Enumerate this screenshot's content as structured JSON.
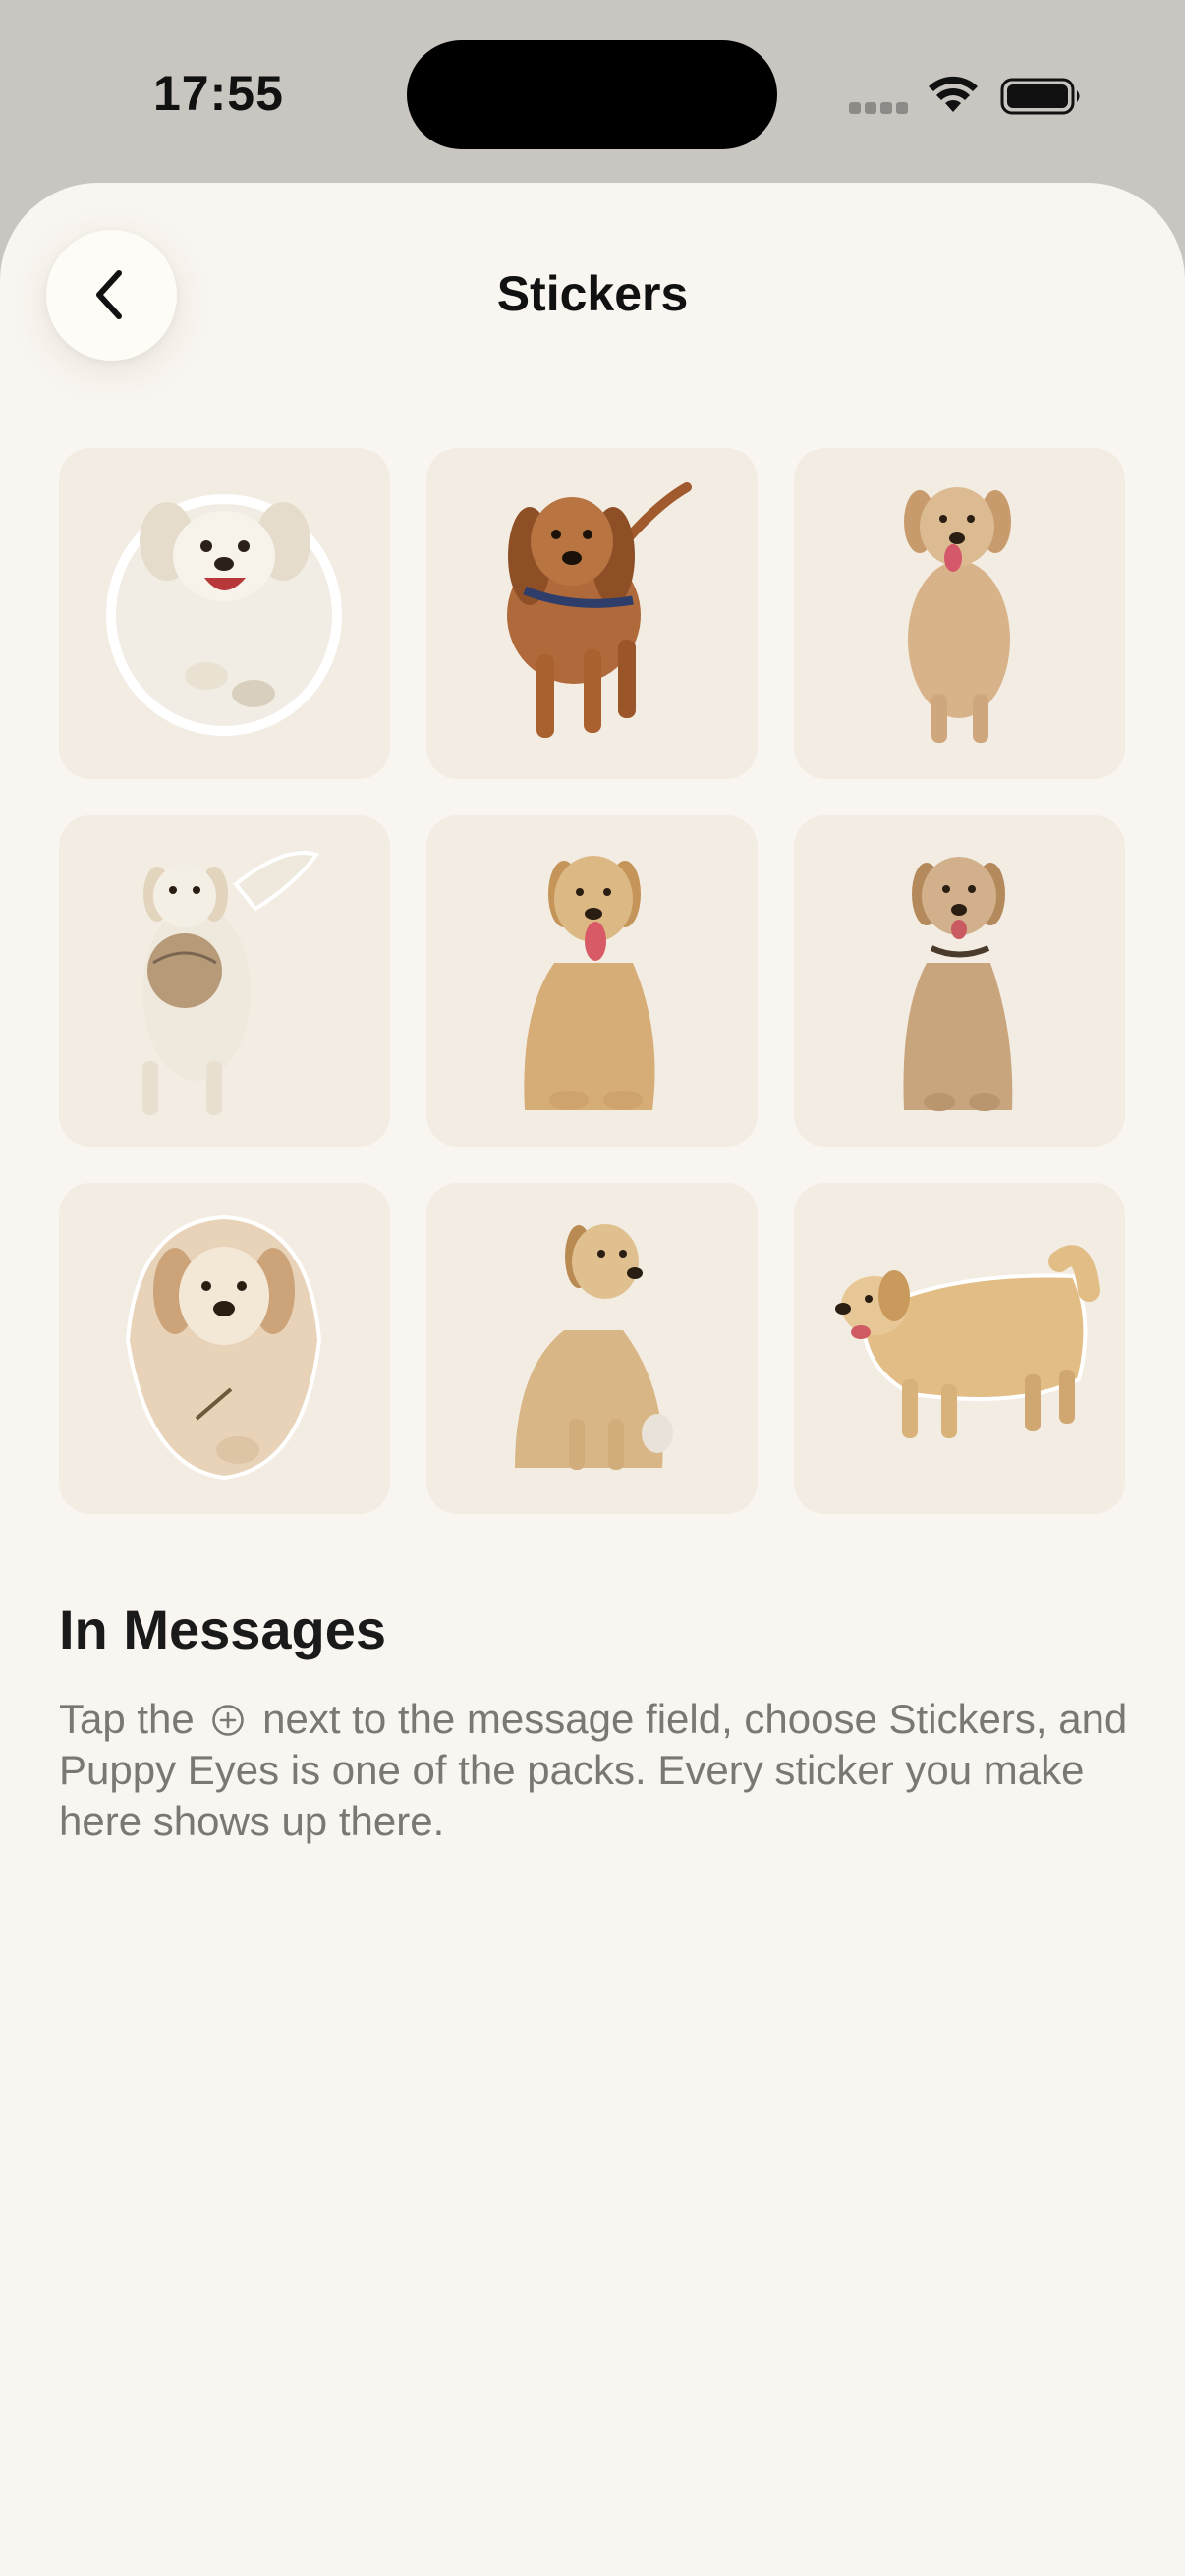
{
  "status_bar": {
    "time": "17:55"
  },
  "header": {
    "title": "Stickers",
    "back_icon": "chevron-left-icon"
  },
  "stickers": [
    {
      "label": "puppy-running",
      "fur": "#f1ede4",
      "outline": "#ffffff"
    },
    {
      "label": "red-puppy-walking",
      "fur": "#b0693a",
      "outline": "#ffffff"
    },
    {
      "label": "golden-standing",
      "fur": "#d8b38a",
      "outline": "#ffffff"
    },
    {
      "label": "puppy-with-ball",
      "fur": "#efe8dc",
      "outline": "#ffffff"
    },
    {
      "label": "golden-sitting-tongue",
      "fur": "#d6ad77",
      "outline": "#ffffff"
    },
    {
      "label": "golden-sitting-collar",
      "fur": "#c9a57e",
      "outline": "#ffffff"
    },
    {
      "label": "golden-lying-front",
      "fur": "#e8d3b9",
      "outline": "#ffffff"
    },
    {
      "label": "golden-sitting-side",
      "fur": "#d9b686",
      "outline": "#ffffff"
    },
    {
      "label": "golden-walking-side",
      "fur": "#e2be86",
      "outline": "#ffffff"
    }
  ],
  "messages_section": {
    "heading": "In Messages",
    "text_before_icon": "Tap the",
    "icon": "plus-circle-icon",
    "text_after_icon": "next to the message field, choose Stickers, and Puppy Eyes is one of the packs. Every sticker you make here shows up there."
  },
  "colors": {
    "sheet_background": "#f9f5f0",
    "cell_background": "#f2ece2",
    "status_bar_background": "#c9c6c1",
    "body_text": "#7b7873"
  }
}
